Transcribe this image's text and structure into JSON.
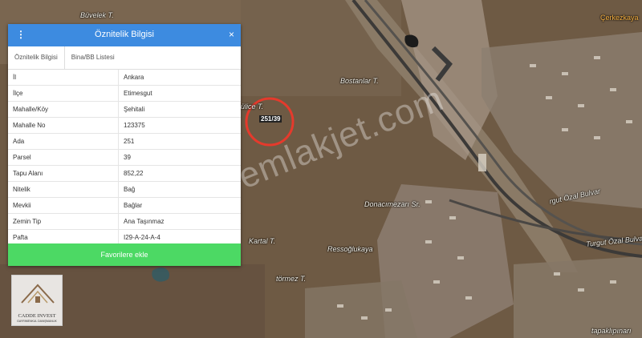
{
  "map": {
    "labels": [
      "Büvelek T.",
      "Çerkezkaya",
      "Bostanlar T.",
      "Kartal T.",
      "Donacımezarı Sr.",
      "Ressoğlukaya",
      "törmez T.",
      "tapaklıpınarı",
      "rgut Özal Bulvar",
      "Turgut Özal Bulvar",
      "ülice T."
    ],
    "parcel_id": "251/39",
    "watermark": "emlakjet.com",
    "logo_text": "CADDE INVEST",
    "logo_sub": "GAYRIMENKUL DANIŞMANLIK"
  },
  "panel": {
    "title": "Öznitelik Bilgisi",
    "menu_glyph": "⋮",
    "close_glyph": "×",
    "tabs": [
      "Öznitelik Bilgisi",
      "Bina/BB Listesi"
    ],
    "rows": [
      {
        "key": "İl",
        "value": "Ankara"
      },
      {
        "key": "İlçe",
        "value": "Etimesgut"
      },
      {
        "key": "Mahalle/Köy",
        "value": "Şehitali"
      },
      {
        "key": "Mahalle No",
        "value": "123375"
      },
      {
        "key": "Ada",
        "value": "251"
      },
      {
        "key": "Parsel",
        "value": "39"
      },
      {
        "key": "Tapu Alanı",
        "value": "852,22"
      },
      {
        "key": "Nitelik",
        "value": "Bağ"
      },
      {
        "key": "Mevkii",
        "value": "Bağlar"
      },
      {
        "key": "Zemin Tip",
        "value": "Ana Taşınmaz"
      },
      {
        "key": "Pafta",
        "value": "I29-A-24-A-4"
      }
    ],
    "favorite_button": "Favorilere ekle"
  }
}
